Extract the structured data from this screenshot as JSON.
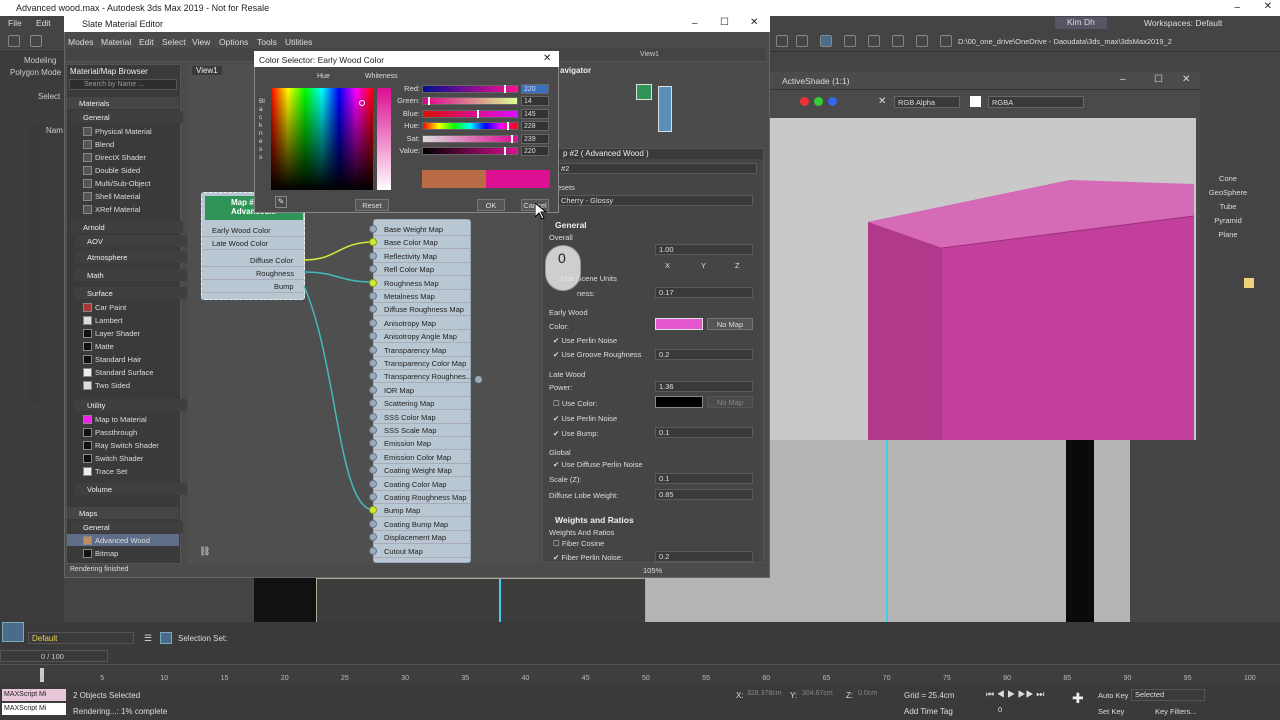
{
  "app": {
    "window_title": "Advanced wood.max - Autodesk 3ds Max 2019 - Not for Resale",
    "menu": [
      "File",
      "Edit"
    ],
    "user": "Kim Dh",
    "workspaces_label": "Workspaces: Default",
    "path": "D:\\00_one_drive\\OneDrive - Daoudata\\3ds_max\\3dsMax2019_2",
    "ribbon": [
      "Modeling",
      "Polygon Mode"
    ],
    "select_label": "Select",
    "name_label": "Nam"
  },
  "sme": {
    "title": "Slate Material Editor",
    "menu": [
      "Modes",
      "Material",
      "Edit",
      "Select",
      "View",
      "Options",
      "Tools",
      "Utilities"
    ],
    "browser_title": "Material/Map Browser",
    "search_placeholder": "Search by Name ...",
    "view_tab": "View1",
    "view_dropdown": "View1",
    "navigator_label": "avigator",
    "status": "Rendering finished",
    "zoom": "105%"
  },
  "browser": {
    "materials": "Materials",
    "general": "General",
    "general_items": [
      "Physical Material",
      "Blend",
      "DirectX Shader",
      "Double Sided",
      "Multi/Sub-Object",
      "Shell Material",
      "XRef Material"
    ],
    "arnold": "Arnold",
    "arnold_groups": [
      "AOV",
      "Atmosphere",
      "Math"
    ],
    "surface": "Surface",
    "surface_items": [
      "Car Paint",
      "Lambert",
      "Layer Shader",
      "Matte",
      "Standard Hair",
      "Standard Surface",
      "Two Sided"
    ],
    "utility": "Utility",
    "utility_items": [
      "Map to Material",
      "Passthrough",
      "Ray Switch Shader",
      "Switch Shader",
      "Trace Set"
    ],
    "volume": "Volume",
    "maps": "Maps",
    "maps_general": "General",
    "maps_items": [
      "Advanced Wood",
      "Bitmap"
    ]
  },
  "node_small": {
    "title": "Map #\nAdvanced...",
    "rows": [
      "Early Wood Color",
      "Late Wood Color",
      "Diffuse Color",
      "Roughness",
      "Bump"
    ]
  },
  "node_big": {
    "rows": [
      "Base Weight Map",
      "Base Color Map",
      "Reflectivity Map",
      "Refl Color Map",
      "Roughness Map",
      "Metalness Map",
      "Diffuse Roughness Map",
      "Anisotropy Map",
      "Anisotropy Angle Map",
      "Transparency Map",
      "Transparency Color Map",
      "Transparency Roughnes...",
      "IOR Map",
      "Scattering Map",
      "SSS Color Map",
      "SSS Scale Map",
      "Emission Map",
      "Emission Color Map",
      "Coating Weight Map",
      "Coating Color Map",
      "Coating Roughness Map",
      "Bump Map",
      "Coating Bump Map",
      "Displacement Map",
      "Cutout Map"
    ],
    "connected": [
      1,
      4,
      21
    ]
  },
  "color_selector": {
    "title": "Color Selector: Early Wood Color",
    "hue_label": "Hue",
    "whiteness_label": "Whiteness",
    "blackness_label": "Blackness",
    "channels": [
      {
        "label": "Red:",
        "value": "220",
        "frac": 0.86
      },
      {
        "label": "Green:",
        "value": "14",
        "frac": 0.05
      },
      {
        "label": "Blue:",
        "value": "145",
        "frac": 0.57
      },
      {
        "label": "Hue:",
        "value": "228",
        "frac": 0.89
      },
      {
        "label": "Sat:",
        "value": "239",
        "frac": 0.94
      },
      {
        "label": "Value:",
        "value": "220",
        "frac": 0.86
      }
    ],
    "old_color": "#b86b44",
    "new_color": "#dc0e91",
    "reset": "Reset",
    "ok": "OK",
    "cancel": "Cancel"
  },
  "props": {
    "header": "p #2  ( Advanced Wood )",
    "name": "#2",
    "presets_label": "esets",
    "preset_value": "Cherry - Glossy",
    "general": "General",
    "overall": "Overall",
    "scale_value": "1.00",
    "axes": [
      "X",
      "Y",
      "Z"
    ],
    "use_scene_units": "Use Scene Units",
    "roughness_label": "ness:",
    "roughness_value": "0.17",
    "early_wood": "Early Wood",
    "color_label": "Color:",
    "no_map": "No Map",
    "use_perlin_noise": "Use Perlin Noise",
    "use_groove_roughness": "Use Groove Roughness",
    "groove_value": "0.2",
    "late_wood": "Late Wood",
    "power_label": "Power:",
    "power_value": "1.36",
    "use_color": "Use Color:",
    "no_map_2": "No Map",
    "use_perlin_noise_2": "Use Perlin Noise",
    "use_bump": "Use Bump:",
    "bump_value": "0.1",
    "global": "Global",
    "use_diffuse_perlin": "Use Diffuse Perlin Noise",
    "scale_z_label": "Scale (Z):",
    "scale_z_value": "0.1",
    "diffuse_lobe_label": "Diffuse Lobe Weight:",
    "diffuse_lobe_value": "0.85",
    "weights": "Weights and Ratios",
    "weights_sub": "Weights And Ratios",
    "fiber_cosine": "Fiber Cosine",
    "fiber_perlin": "Fiber Perlin Noise:",
    "fiber_value": "0.2",
    "early_color": "#e457d0"
  },
  "activeshade": {
    "title": "ActiveShade (1:1)",
    "channel": "RGB Alpha",
    "channel2": "RGBA"
  },
  "command_panel": [
    "Cone",
    "GeoSphere",
    "Tube",
    "Pyramid",
    "Plane"
  ],
  "status_bar": {
    "layer": "Default",
    "selection_set": "Selection Set:",
    "frame": "0 / 100",
    "objects_selected": "2 Objects Selected",
    "rendering": "Rendering...: 1% complete",
    "maxscript": "MAXScript Mi",
    "x_label": "X:",
    "x_value": "328.378cm",
    "y_label": "Y:",
    "y_value": "304.67cm",
    "z_label": "Z:",
    "z_value": "0.0cm",
    "grid": "Grid = 25.4cm",
    "add_time_tag": "Add Time Tag",
    "auto_key": "Auto Key",
    "set_key": "Set Key",
    "selected": "Selected",
    "key_filters": "Key Filters...",
    "frame_field": "0"
  },
  "timeline_ticks": [
    "0",
    "5",
    "10",
    "15",
    "20",
    "25",
    "30",
    "35",
    "40",
    "45",
    "50",
    "55",
    "60",
    "65",
    "70",
    "75",
    "80",
    "85",
    "90",
    "95",
    "100"
  ]
}
